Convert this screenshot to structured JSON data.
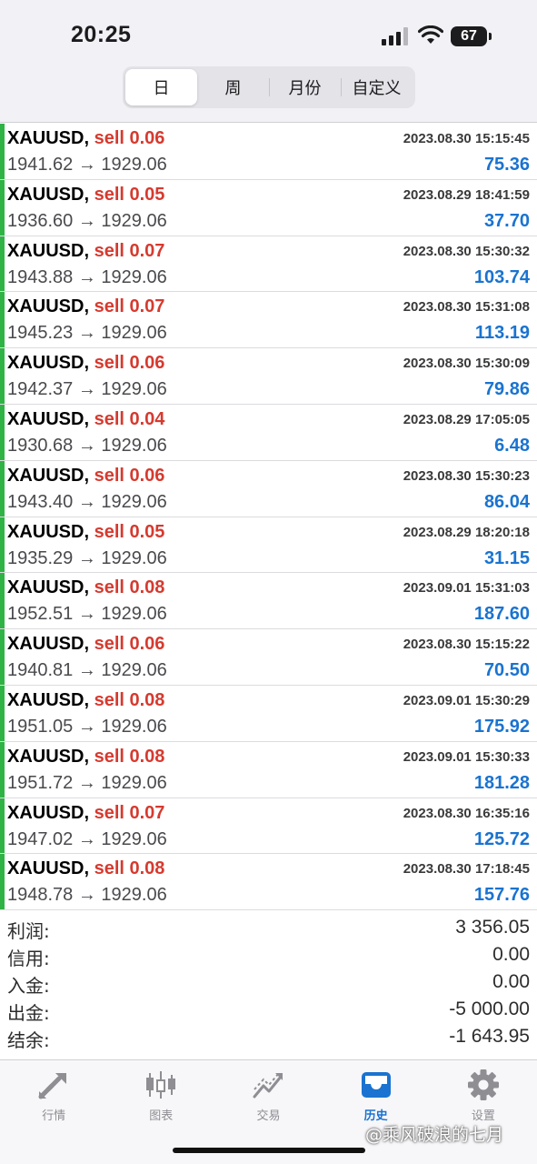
{
  "status": {
    "time": "20:25",
    "battery": "67"
  },
  "tabs": [
    {
      "label": "日"
    },
    {
      "label": "周"
    },
    {
      "label": "月份"
    },
    {
      "label": "自定义"
    }
  ],
  "trades": [
    {
      "symbol": "XAUUSD,",
      "side": "sell 0.06",
      "datetime": "2023.08.30 15:15:45",
      "prices": "1941.62 → 1929.06",
      "profit": "75.36"
    },
    {
      "symbol": "XAUUSD,",
      "side": "sell 0.05",
      "datetime": "2023.08.29 18:41:59",
      "prices": "1936.60 → 1929.06",
      "profit": "37.70"
    },
    {
      "symbol": "XAUUSD,",
      "side": "sell 0.07",
      "datetime": "2023.08.30 15:30:32",
      "prices": "1943.88 → 1929.06",
      "profit": "103.74"
    },
    {
      "symbol": "XAUUSD,",
      "side": "sell 0.07",
      "datetime": "2023.08.30 15:31:08",
      "prices": "1945.23 → 1929.06",
      "profit": "113.19"
    },
    {
      "symbol": "XAUUSD,",
      "side": "sell 0.06",
      "datetime": "2023.08.30 15:30:09",
      "prices": "1942.37 → 1929.06",
      "profit": "79.86"
    },
    {
      "symbol": "XAUUSD,",
      "side": "sell 0.04",
      "datetime": "2023.08.29 17:05:05",
      "prices": "1930.68 → 1929.06",
      "profit": "6.48"
    },
    {
      "symbol": "XAUUSD,",
      "side": "sell 0.06",
      "datetime": "2023.08.30 15:30:23",
      "prices": "1943.40 → 1929.06",
      "profit": "86.04"
    },
    {
      "symbol": "XAUUSD,",
      "side": "sell 0.05",
      "datetime": "2023.08.29 18:20:18",
      "prices": "1935.29 → 1929.06",
      "profit": "31.15"
    },
    {
      "symbol": "XAUUSD,",
      "side": "sell 0.08",
      "datetime": "2023.09.01 15:31:03",
      "prices": "1952.51 → 1929.06",
      "profit": "187.60"
    },
    {
      "symbol": "XAUUSD,",
      "side": "sell 0.06",
      "datetime": "2023.08.30 15:15:22",
      "prices": "1940.81 → 1929.06",
      "profit": "70.50"
    },
    {
      "symbol": "XAUUSD,",
      "side": "sell 0.08",
      "datetime": "2023.09.01 15:30:29",
      "prices": "1951.05 → 1929.06",
      "profit": "175.92"
    },
    {
      "symbol": "XAUUSD,",
      "side": "sell 0.08",
      "datetime": "2023.09.01 15:30:33",
      "prices": "1951.72 → 1929.06",
      "profit": "181.28"
    },
    {
      "symbol": "XAUUSD,",
      "side": "sell 0.07",
      "datetime": "2023.08.30 16:35:16",
      "prices": "1947.02 → 1929.06",
      "profit": "125.72"
    },
    {
      "symbol": "XAUUSD,",
      "side": "sell 0.08",
      "datetime": "2023.08.30 17:18:45",
      "prices": "1948.78 → 1929.06",
      "profit": "157.76"
    }
  ],
  "summary": [
    {
      "label": "利润:",
      "value": "3 356.05"
    },
    {
      "label": "信用:",
      "value": "0.00"
    },
    {
      "label": "入金:",
      "value": "0.00"
    },
    {
      "label": "出金:",
      "value": "-5 000.00"
    },
    {
      "label": "结余:",
      "value": "-1 643.95"
    }
  ],
  "bottom_nav": [
    {
      "label": "行情",
      "icon": "quotes-arrows-icon"
    },
    {
      "label": "图表",
      "icon": "candlestick-chart-icon"
    },
    {
      "label": "交易",
      "icon": "trade-chart-icon"
    },
    {
      "label": "历史",
      "icon": "history-tray-icon"
    },
    {
      "label": "设置",
      "icon": "gear-icon"
    }
  ],
  "watermark": "@乘风破浪的七月",
  "colors": {
    "accent": "#1a73d0",
    "sell": "#d63a2f",
    "profit_bar": "#2fb344",
    "inactive": "#8e8e93"
  }
}
